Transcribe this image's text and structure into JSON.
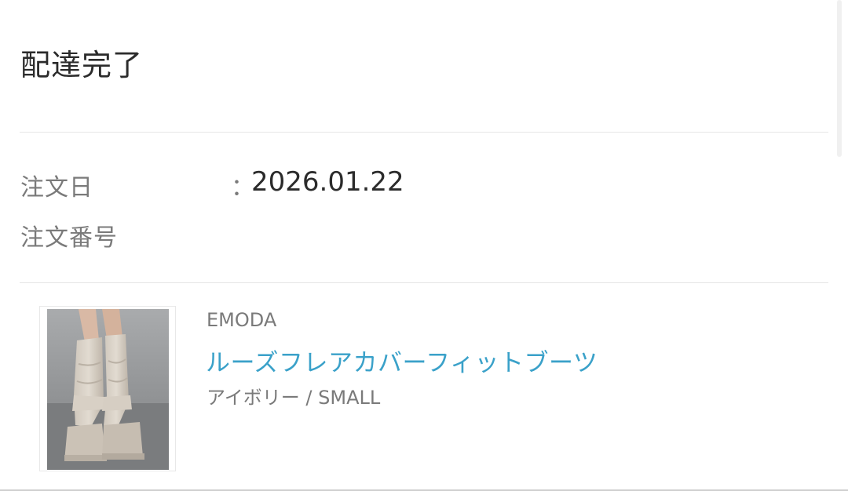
{
  "order": {
    "status": "配達完了",
    "date_label": "注文日",
    "date_colon": "：",
    "date_value": "2026.01.22",
    "number_label": "注文番号",
    "number_value": ""
  },
  "product": {
    "brand": "EMODA",
    "name": "ルーズフレアカバーフィットブーツ",
    "variant": "アイボリー / SMALL",
    "image_icon": "product-photo-boots"
  },
  "colors": {
    "link": "#3aa1c9",
    "text": "#2b2b2b",
    "muted": "#7a7a7a"
  }
}
